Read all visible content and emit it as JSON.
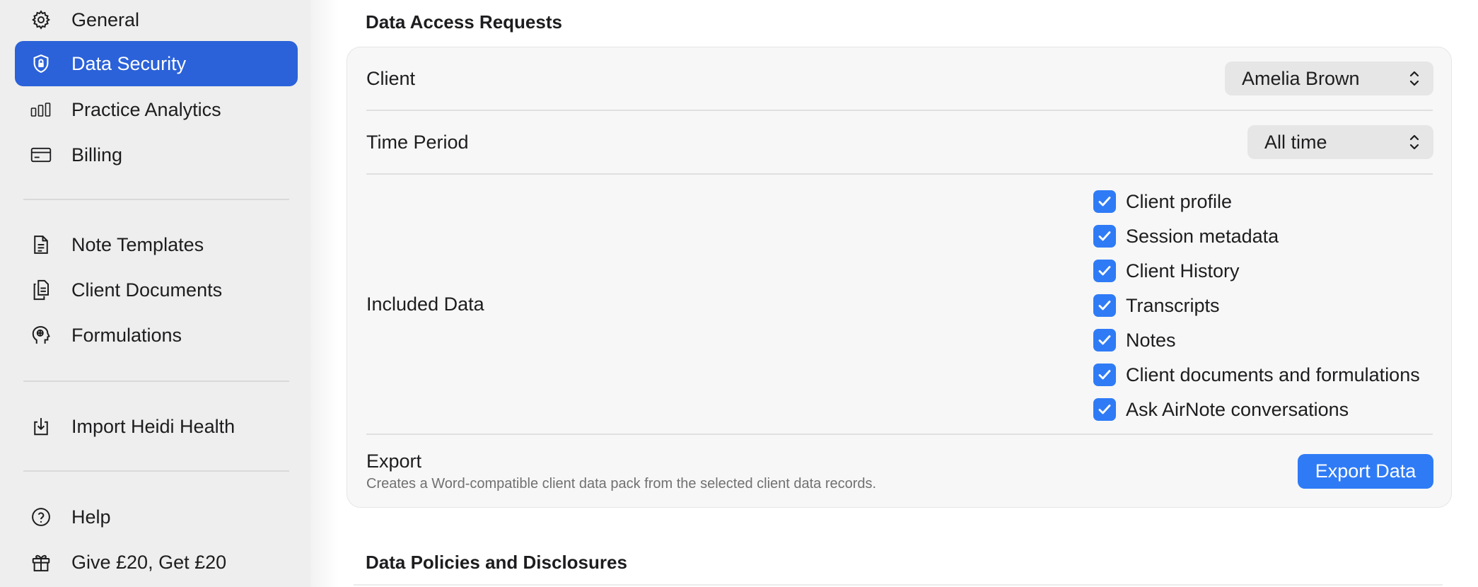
{
  "sidebar": {
    "items": [
      {
        "label": "General",
        "icon": "gear-icon",
        "active": false
      },
      {
        "label": "Data Security",
        "icon": "shield-lock-icon",
        "active": true
      },
      {
        "label": "Practice Analytics",
        "icon": "bar-chart-icon",
        "active": false
      },
      {
        "label": "Billing",
        "icon": "credit-card-icon",
        "active": false
      },
      {
        "label": "Note Templates",
        "icon": "document-icon",
        "active": false
      },
      {
        "label": "Client Documents",
        "icon": "documents-icon",
        "active": false
      },
      {
        "label": "Formulations",
        "icon": "head-brain-icon",
        "active": false
      },
      {
        "label": "Import Heidi Health",
        "icon": "import-tray-icon",
        "active": false
      },
      {
        "label": "Help",
        "icon": "question-circle-icon",
        "active": false
      },
      {
        "label": "Give £20, Get £20",
        "icon": "gift-icon",
        "active": false
      }
    ]
  },
  "main": {
    "section_title": "Data Access Requests",
    "client": {
      "label": "Client",
      "value": "Amelia Brown"
    },
    "time_period": {
      "label": "Time Period",
      "value": "All time"
    },
    "included_data": {
      "label": "Included Data",
      "options": [
        {
          "label": "Client profile",
          "checked": true
        },
        {
          "label": "Session metadata",
          "checked": true
        },
        {
          "label": "Client History",
          "checked": true
        },
        {
          "label": "Transcripts",
          "checked": true
        },
        {
          "label": "Notes",
          "checked": true
        },
        {
          "label": "Client documents and formulations",
          "checked": true
        },
        {
          "label": "Ask AirNote conversations",
          "checked": true
        }
      ]
    },
    "export": {
      "label": "Export",
      "description": "Creates a Word-compatible client data pack from the selected client data records.",
      "button_label": "Export Data"
    },
    "next_section_title": "Data Policies and Disclosures"
  },
  "colors": {
    "accent": "#2b62d9",
    "checkbox": "#2f7bf6",
    "sidebar_bg": "#eeeeee"
  }
}
